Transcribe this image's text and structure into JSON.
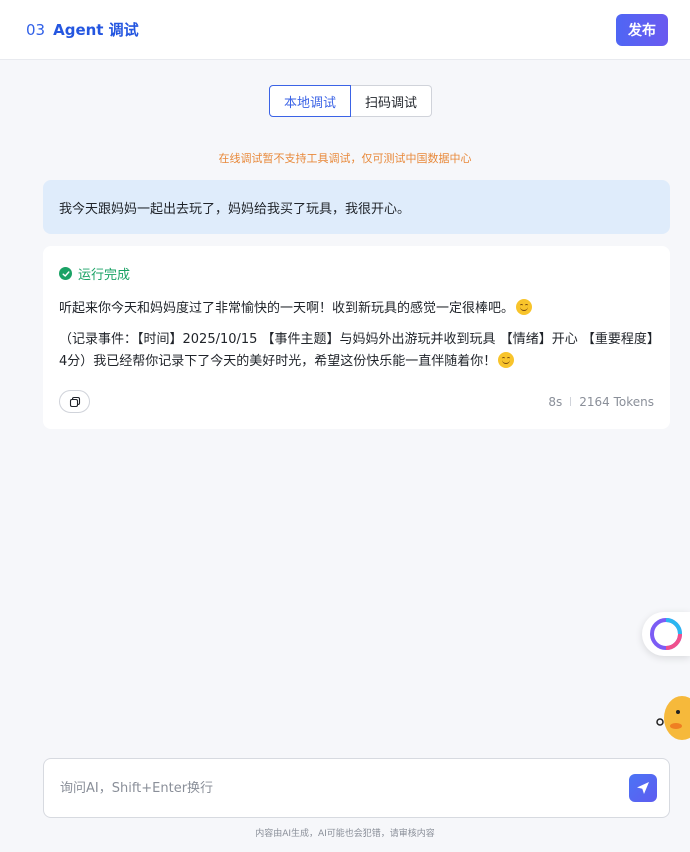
{
  "header": {
    "step_number": "03",
    "title": "Agent 调试",
    "publish_label": "发布"
  },
  "tabs": [
    {
      "label": "本地调试",
      "active": true
    },
    {
      "label": "扫码调试",
      "active": false
    }
  ],
  "notice": "在线调试暂不支持工具调试，仅可测试中国数据中心",
  "conversation": {
    "user_message": "我今天跟妈妈一起出去玩了，妈妈给我买了玩具，我很开心。",
    "ai_status": "运行完成",
    "ai_reply_1": "听起来你今天和妈妈度过了非常愉快的一天啊！收到新玩具的感觉一定很棒吧。",
    "ai_reply_2": "（记录事件：【时间】2025/10/15 【事件主题】与妈妈外出游玩并收到玩具 【情绪】开心 【重要程度】4分）我已经帮你记录下了今天的美好时光，希望这份快乐能一直伴随着你！",
    "duration": "8s",
    "tokens": "2164 Tokens"
  },
  "input": {
    "placeholder": "询问AI，Shift+Enter换行"
  },
  "disclaimer": "内容由AI生成，AI可能也会犯错，请审核内容",
  "colors": {
    "accent": "#3b63e6",
    "success": "#1aa265",
    "notice": "#e8893a",
    "user_bubble": "#dfecfb"
  }
}
